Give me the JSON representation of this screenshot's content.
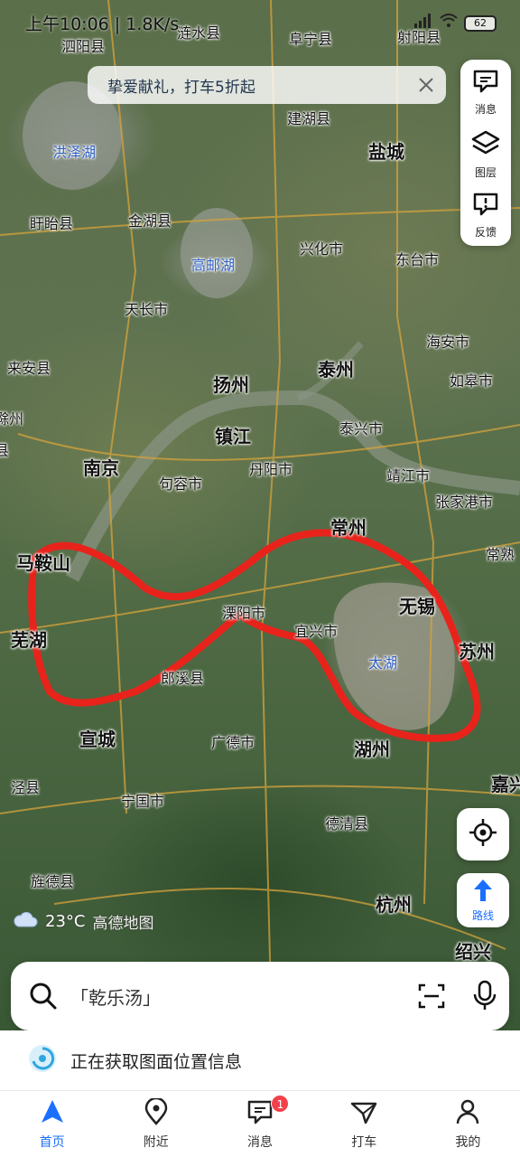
{
  "status_bar": {
    "time": "上午10:06 | 1.8K/s",
    "battery": "62"
  },
  "banner": {
    "text": "挚爱献礼，打车5折起"
  },
  "side_tools": [
    {
      "label": "消息",
      "icon": "message-icon"
    },
    {
      "label": "图层",
      "icon": "layers-icon"
    },
    {
      "label": "反馈",
      "icon": "feedback-icon"
    }
  ],
  "route_button": {
    "label": "路线"
  },
  "weather": {
    "temperature": "23°C",
    "brand": "高德地图"
  },
  "search": {
    "placeholder": "「乾乐汤」"
  },
  "location_info": {
    "text": "正在获取图面位置信息"
  },
  "tabs": [
    {
      "label": "首页",
      "active": true
    },
    {
      "label": "附近",
      "active": false
    },
    {
      "label": "消息",
      "active": false,
      "badge": "1"
    },
    {
      "label": "打车",
      "active": false
    },
    {
      "label": "我的",
      "active": false
    }
  ],
  "map_labels": {
    "sishui": "泗阳县",
    "lianshui": "涟水县",
    "funing": "阜宁县",
    "sheyang": "射阳县",
    "jianhu": "建湖县",
    "yancheng": "盐城",
    "hongze_lake": "洪泽湖",
    "xuyi": "盱眙县",
    "jinhu": "金湖县",
    "gaoyou_lake": "高邮湖",
    "xinghua": "兴化市",
    "dongtai": "东台市",
    "tianchang": "天长市",
    "haian": "海安市",
    "laian": "来安县",
    "yangzhou": "扬州",
    "taizhou": "泰州",
    "rugao": "如皋市",
    "chuzhou": "滁州",
    "zhenjiang": "镇江",
    "taixing": "泰兴市",
    "nanjing": "南京",
    "jurong": "句容市",
    "danyang": "丹阳市",
    "jingjiang": "靖江市",
    "zhangjiagang": "张家港市",
    "changzhou": "常州",
    "maanshan": "马鞍山",
    "changshu": "常熟",
    "liyang": "溧阳市",
    "wuxi": "无锡",
    "yixing": "宜兴市",
    "wuhu": "芜湖",
    "suzhou": "苏州",
    "taihu": "太湖",
    "langxi": "郎溪县",
    "xuancheng": "宣城",
    "guangde": "广德市",
    "huzhou": "湖州",
    "jiaxing": "嘉兴",
    "jingxian": "泾县",
    "ningguo": "宁国市",
    "deqing": "德清县",
    "jingde": "旌德县",
    "hangzhou": "杭州",
    "shaoxing": "绍兴",
    "county_left": "县"
  }
}
